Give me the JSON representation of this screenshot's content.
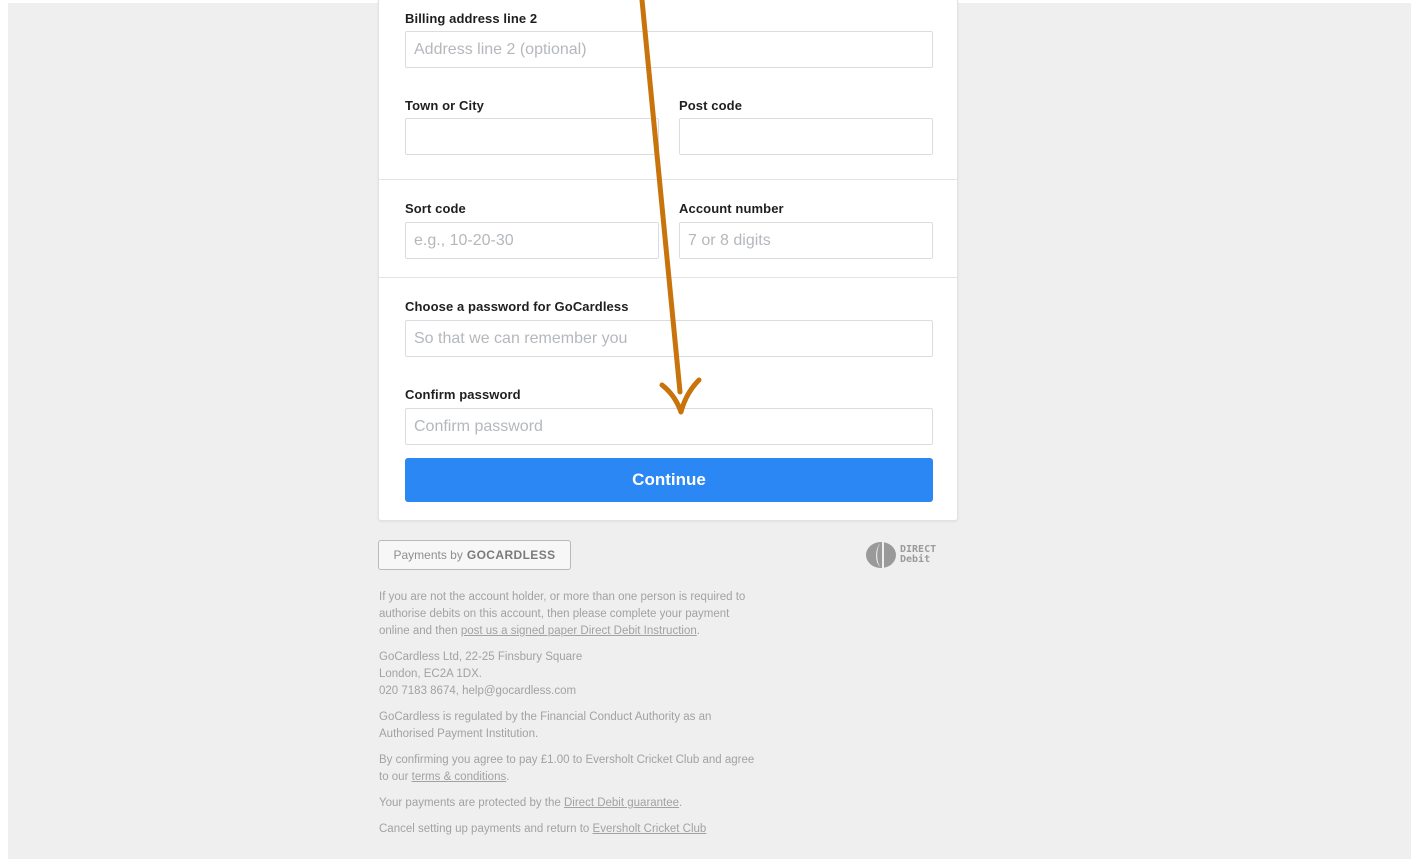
{
  "form": {
    "billing_line2": {
      "label": "Billing address line 2",
      "placeholder": "Address line 2 (optional)"
    },
    "town": {
      "label": "Town or City",
      "placeholder": ""
    },
    "postcode": {
      "label": "Post code",
      "placeholder": ""
    },
    "sort_code": {
      "label": "Sort code",
      "placeholder": "e.g., 10-20-30"
    },
    "account_number": {
      "label": "Account number",
      "placeholder": "7 or 8 digits"
    },
    "password": {
      "label": "Choose a password for GoCardless",
      "placeholder": "So that we can remember you"
    },
    "confirm_password": {
      "label": "Confirm password",
      "placeholder": "Confirm password"
    },
    "continue_label": "Continue"
  },
  "badge": {
    "prefix": "Payments by",
    "brand": "GOCARDLESS"
  },
  "direct_debit": {
    "line1": "DIRECT",
    "line2": "Debit"
  },
  "footer": {
    "holder_text": "If you are not the account holder, or more than one person is required to authorise debits on this account, then please complete your payment online and then",
    "holder_link": "post us a signed paper Direct Debit Instruction",
    "holder_end": ".",
    "address_line1": "GoCardless Ltd, 22-25 Finsbury Square",
    "address_line2": "London, EC2A 1DX.",
    "address_line3": "020 7183 8674, help@gocardless.com",
    "regulation": "GoCardless is regulated by the Financial Conduct Authority as an Authorised Payment Institution.",
    "agree_text": "By confirming you agree to pay £1.00 to Eversholt Cricket Club and agree to our",
    "terms_link": "terms & conditions",
    "agree_end": ".",
    "protected_text": "Your payments are protected by the",
    "guarantee_link": "Direct Debit guarantee",
    "protected_end": ".",
    "cancel_text": "Cancel setting up payments and return to",
    "club_link": "Eversholt Cricket Club"
  },
  "colors": {
    "primary_button": "#2b87f3",
    "annotation_arrow": "#c8730b",
    "page_background": "#efefef"
  }
}
